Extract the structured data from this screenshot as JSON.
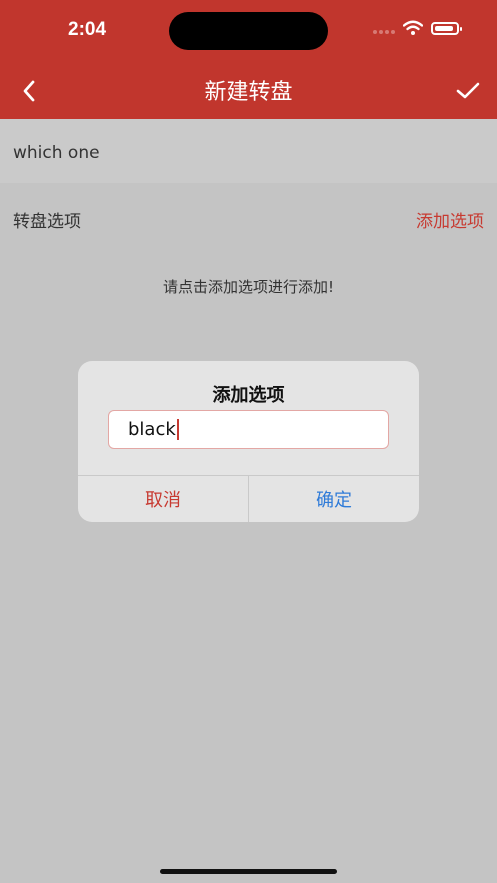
{
  "status_bar": {
    "time": "2:04"
  },
  "header": {
    "title": "新建转盘",
    "back_icon": "chevron-left-icon",
    "confirm_icon": "checkmark-icon"
  },
  "name_field": {
    "value": "which one"
  },
  "options": {
    "label": "转盘选项",
    "add_link": "添加选项",
    "empty_hint": "请点击添加选项进行添加!"
  },
  "dialog": {
    "title": "添加选项",
    "input_value": "black",
    "cancel_label": "取消",
    "ok_label": "确定"
  },
  "colors": {
    "header_bg": "#c1362d",
    "accent_red": "#c73a31",
    "ok_blue": "#2f7bd8",
    "backdrop": "#c4c4c4"
  }
}
